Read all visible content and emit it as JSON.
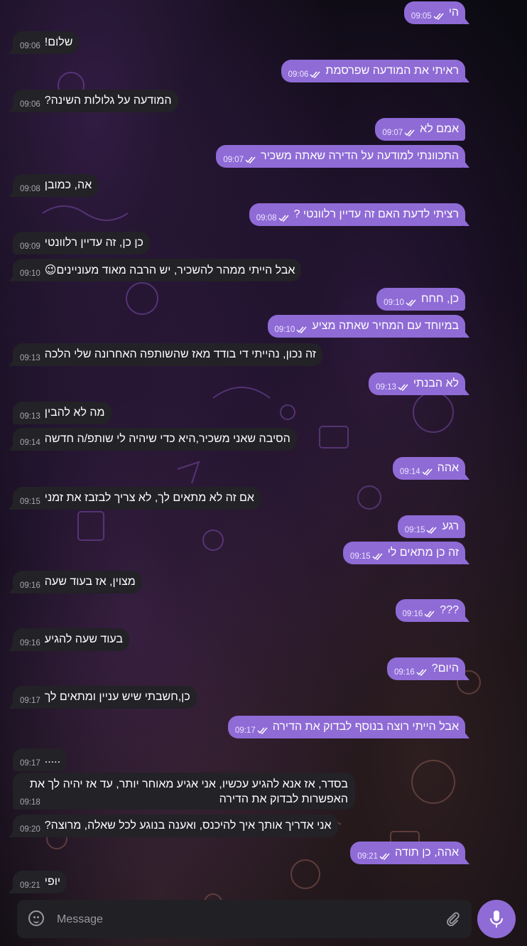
{
  "theme": {
    "outgoing_bubble": "#8f6bd6",
    "incoming_bubble": "#232227",
    "accent": "#8f6bd6"
  },
  "messages": [
    {
      "dir": "out",
      "text": "הי",
      "time": "09:05"
    },
    {
      "dir": "in",
      "text": "שלום!",
      "time": "09:06"
    },
    {
      "dir": "out",
      "text": "ראיתי את המודעה שפרסמת",
      "time": "09:06"
    },
    {
      "dir": "in",
      "text": "המודעה על גלולות השינה?",
      "time": "09:06"
    },
    {
      "dir": "out",
      "text": "אמם לא",
      "time": "09:07"
    },
    {
      "dir": "out",
      "text": "התכוונתי למודעה על הדירה שאתה משכיר",
      "time": "09:07"
    },
    {
      "dir": "in",
      "text": "אה, כמובן",
      "time": "09:08"
    },
    {
      "dir": "out",
      "text": "רציתי לדעת האם זה עדיין רלוונטי ?",
      "time": "09:08"
    },
    {
      "dir": "in",
      "text": "כן כן, זה עדיין רלוונטי",
      "time": "09:09"
    },
    {
      "dir": "in",
      "text": "אבל הייתי ממהר להשכיר, יש הרבה מאוד מעוניינים😉",
      "time": "09:10"
    },
    {
      "dir": "out",
      "text": "כן, חחח",
      "time": "09:10"
    },
    {
      "dir": "out",
      "text": "במיוחד עם המחיר שאתה מציע",
      "time": "09:10"
    },
    {
      "dir": "in",
      "text": "זה נכון, נהייתי די בודד מאז שהשותפה האחרונה שלי הלכה",
      "time": "09:13"
    },
    {
      "dir": "out",
      "text": "לא הבנתי",
      "time": "09:13"
    },
    {
      "dir": "in",
      "text": "מה לא להבין",
      "time": "09:13"
    },
    {
      "dir": "in",
      "text": "הסיבה שאני משכיר,היא כדי שיהיה לי שותפ/ה חדשה",
      "time": "09:14"
    },
    {
      "dir": "out",
      "text": "אהה",
      "time": "09:14"
    },
    {
      "dir": "in",
      "text": "אם זה לא מתאים לך, לא צריך לבזבז את זמני",
      "time": "09:15"
    },
    {
      "dir": "out",
      "text": "רגע",
      "time": "09:15"
    },
    {
      "dir": "out",
      "text": "זה כן מתאים לי",
      "time": "09:15"
    },
    {
      "dir": "in",
      "text": "מצוין, אז בעוד שעה",
      "time": "09:16"
    },
    {
      "dir": "out",
      "text": "???",
      "time": "09:16"
    },
    {
      "dir": "in",
      "text": "בעוד שעה להגיע",
      "time": "09:16"
    },
    {
      "dir": "out",
      "text": "היום?",
      "time": "09:16"
    },
    {
      "dir": "in",
      "text": "כן,חשבתי שיש עניין ומתאים לך",
      "time": "09:17"
    },
    {
      "dir": "out",
      "text": "אבל הייתי רוצה בנוסף לבדוק את הדירה",
      "time": "09:17"
    },
    {
      "dir": "in",
      "text": ".....",
      "time": "09:17"
    },
    {
      "dir": "in",
      "text": "בסדר, אז אנא להגיע עכשיו, אני אגיע מאוחר יותר, עד אז יהיה לך את האפשרות לבדוק את הדירה",
      "time": "09:18"
    },
    {
      "dir": "in",
      "text": "אני אדריך אותך איך להיכנס, ואענה בנוגע לכל שאלה, מרוצה?",
      "time": "09:20"
    },
    {
      "dir": "out",
      "text": "אהה, כן תודה",
      "time": "09:21"
    },
    {
      "dir": "in",
      "text": "יופי",
      "time": "09:21"
    }
  ],
  "composer": {
    "placeholder": "Message"
  }
}
